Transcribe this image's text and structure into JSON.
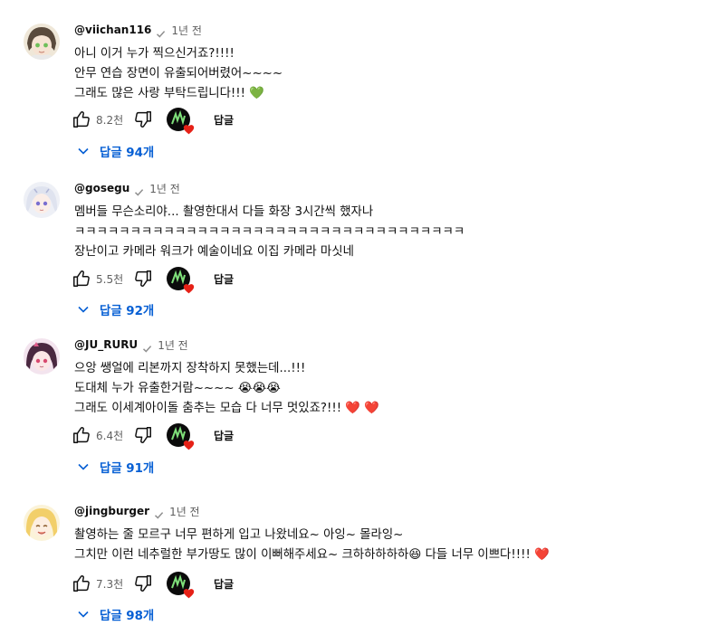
{
  "reply_label": "답글",
  "colors": {
    "link": "#065fd4",
    "heart": "#e62117",
    "secondary": "#606060"
  },
  "comments": [
    {
      "author": "@viichan116",
      "time": "1년 전",
      "lines": [
        "아니 이거 누가 찍으신거죠?!!!!",
        "안무 연습 장면이 유출되어버렸어~~~~",
        "그래도 많은 사랑 부탁드립니다!!! 💚"
      ],
      "likes": "8.2천",
      "replies": "답글 94개"
    },
    {
      "author": "@gosegu",
      "time": "1년 전",
      "lines": [
        "멤버들  무슨소리야... 촬영한대서 다들 화장 3시간씩 했자나",
        "ㅋㅋㅋㅋㅋㅋㅋㅋㅋㅋㅋㅋㅋㅋㅋㅋㅋㅋㅋㅋㅋㅋㅋㅋㅋㅋㅋㅋㅋㅋㅋㅋㅋㅋㅋ",
        "장난이고 카메라 워크가 예술이네요 이집 카메라 마싯네"
      ],
      "likes": "5.5천",
      "replies": "답글 92개"
    },
    {
      "author": "@JU_RURU",
      "time": "1년 전",
      "lines": [
        "으앙 쌩얼에 리본까지 장착하지 못했는데...!!!",
        "도대체 누가 유출한거람~~~~ 😭😭😭",
        "그래도 이세계아이돌 춤추는 모습 다 너무 멋있죠?!!! ❤️ ❤️"
      ],
      "likes": "6.4천",
      "replies": "답글 91개"
    },
    {
      "author": "@jingburger",
      "time": "1년 전",
      "lines": [
        "촬영하는 줄 모르구 너무 편하게 입고 나왔네요~ 아잉~ 몰라잉~",
        "그치만 이런 네추럴한 부가땅도 많이 이뻐해주세요~ 크하하하하하😆 다들 너무 이쁘다!!!! ❤️"
      ],
      "likes": "7.3천",
      "replies": "답글 98개"
    }
  ]
}
